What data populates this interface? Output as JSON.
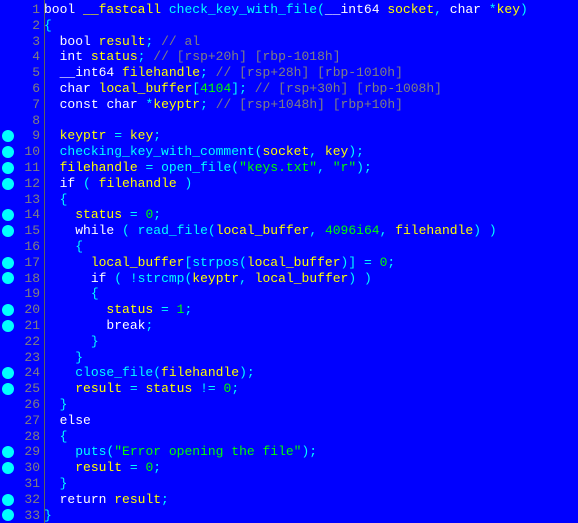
{
  "lines": [
    {
      "n": 1,
      "bp": false,
      "tokens": [
        [
          "ty",
          "bool"
        ],
        [
          "pl",
          " "
        ],
        [
          "id",
          "__fastcall"
        ],
        [
          "pl",
          " "
        ],
        [
          "fn",
          "check_key_with_file"
        ],
        [
          "pn",
          "("
        ],
        [
          "ty",
          "__int64"
        ],
        [
          "pl",
          " "
        ],
        [
          "id",
          "socket"
        ],
        [
          "pn",
          ","
        ],
        [
          "pl",
          " "
        ],
        [
          "ty",
          "char"
        ],
        [
          "pl",
          " "
        ],
        [
          "op",
          "*"
        ],
        [
          "id",
          "key"
        ],
        [
          "pn",
          ")"
        ]
      ]
    },
    {
      "n": 2,
      "bp": false,
      "tokens": [
        [
          "pn",
          "{"
        ]
      ]
    },
    {
      "n": 3,
      "bp": false,
      "tokens": [
        [
          "pl",
          "  "
        ],
        [
          "ty",
          "bool"
        ],
        [
          "pl",
          " "
        ],
        [
          "id",
          "result"
        ],
        [
          "pn",
          ";"
        ],
        [
          "pl",
          " "
        ],
        [
          "cmt",
          "// al"
        ]
      ]
    },
    {
      "n": 4,
      "bp": false,
      "tokens": [
        [
          "pl",
          "  "
        ],
        [
          "ty",
          "int"
        ],
        [
          "pl",
          " "
        ],
        [
          "id",
          "status"
        ],
        [
          "pn",
          ";"
        ],
        [
          "pl",
          " "
        ],
        [
          "cmt",
          "// [rsp+20h] [rbp-1018h]"
        ]
      ]
    },
    {
      "n": 5,
      "bp": false,
      "tokens": [
        [
          "pl",
          "  "
        ],
        [
          "ty",
          "__int64"
        ],
        [
          "pl",
          " "
        ],
        [
          "id",
          "filehandle"
        ],
        [
          "pn",
          ";"
        ],
        [
          "pl",
          " "
        ],
        [
          "cmt",
          "// [rsp+28h] [rbp-1010h]"
        ]
      ]
    },
    {
      "n": 6,
      "bp": false,
      "tokens": [
        [
          "pl",
          "  "
        ],
        [
          "ty",
          "char"
        ],
        [
          "pl",
          " "
        ],
        [
          "id",
          "local_buffer"
        ],
        [
          "pn",
          "["
        ],
        [
          "num",
          "4104"
        ],
        [
          "pn",
          "]"
        ],
        [
          "pn",
          ";"
        ],
        [
          "pl",
          " "
        ],
        [
          "cmt",
          "// [rsp+30h] [rbp-1008h]"
        ]
      ]
    },
    {
      "n": 7,
      "bp": false,
      "tokens": [
        [
          "pl",
          "  "
        ],
        [
          "ty",
          "const"
        ],
        [
          "pl",
          " "
        ],
        [
          "ty",
          "char"
        ],
        [
          "pl",
          " "
        ],
        [
          "op",
          "*"
        ],
        [
          "id",
          "keyptr"
        ],
        [
          "pn",
          ";"
        ],
        [
          "pl",
          " "
        ],
        [
          "cmt",
          "// [rsp+1048h] [rbp+10h]"
        ]
      ]
    },
    {
      "n": 8,
      "bp": false,
      "tokens": []
    },
    {
      "n": 9,
      "bp": true,
      "tokens": [
        [
          "pl",
          "  "
        ],
        [
          "id",
          "keyptr"
        ],
        [
          "pl",
          " "
        ],
        [
          "op",
          "="
        ],
        [
          "pl",
          " "
        ],
        [
          "id",
          "key"
        ],
        [
          "pn",
          ";"
        ]
      ]
    },
    {
      "n": 10,
      "bp": true,
      "tokens": [
        [
          "pl",
          "  "
        ],
        [
          "fn",
          "checking_key_with_comment"
        ],
        [
          "pn",
          "("
        ],
        [
          "id",
          "socket"
        ],
        [
          "pn",
          ","
        ],
        [
          "pl",
          " "
        ],
        [
          "id",
          "key"
        ],
        [
          "pn",
          ")"
        ],
        [
          "pn",
          ";"
        ]
      ]
    },
    {
      "n": 11,
      "bp": true,
      "tokens": [
        [
          "pl",
          "  "
        ],
        [
          "id",
          "filehandle"
        ],
        [
          "pl",
          " "
        ],
        [
          "op",
          "="
        ],
        [
          "pl",
          " "
        ],
        [
          "fn",
          "open_file"
        ],
        [
          "pn",
          "("
        ],
        [
          "str",
          "\"keys.txt\""
        ],
        [
          "pn",
          ","
        ],
        [
          "pl",
          " "
        ],
        [
          "str",
          "\"r\""
        ],
        [
          "pn",
          ")"
        ],
        [
          "pn",
          ";"
        ]
      ]
    },
    {
      "n": 12,
      "bp": true,
      "tokens": [
        [
          "pl",
          "  "
        ],
        [
          "kw",
          "if"
        ],
        [
          "pl",
          " "
        ],
        [
          "pn",
          "("
        ],
        [
          "pl",
          " "
        ],
        [
          "id",
          "filehandle"
        ],
        [
          "pl",
          " "
        ],
        [
          "pn",
          ")"
        ]
      ]
    },
    {
      "n": 13,
      "bp": false,
      "tokens": [
        [
          "pl",
          "  "
        ],
        [
          "pn",
          "{"
        ]
      ]
    },
    {
      "n": 14,
      "bp": true,
      "tokens": [
        [
          "pl",
          "    "
        ],
        [
          "id",
          "status"
        ],
        [
          "pl",
          " "
        ],
        [
          "op",
          "="
        ],
        [
          "pl",
          " "
        ],
        [
          "num",
          "0"
        ],
        [
          "pn",
          ";"
        ]
      ]
    },
    {
      "n": 15,
      "bp": true,
      "tokens": [
        [
          "pl",
          "    "
        ],
        [
          "kw",
          "while"
        ],
        [
          "pl",
          " "
        ],
        [
          "pn",
          "("
        ],
        [
          "pl",
          " "
        ],
        [
          "fn",
          "read_file"
        ],
        [
          "pn",
          "("
        ],
        [
          "id",
          "local_buffer"
        ],
        [
          "pn",
          ","
        ],
        [
          "pl",
          " "
        ],
        [
          "num",
          "4096i64"
        ],
        [
          "pn",
          ","
        ],
        [
          "pl",
          " "
        ],
        [
          "id",
          "filehandle"
        ],
        [
          "pn",
          ")"
        ],
        [
          "pl",
          " "
        ],
        [
          "pn",
          ")"
        ]
      ]
    },
    {
      "n": 16,
      "bp": false,
      "tokens": [
        [
          "pl",
          "    "
        ],
        [
          "pn",
          "{"
        ]
      ]
    },
    {
      "n": 17,
      "bp": true,
      "tokens": [
        [
          "pl",
          "      "
        ],
        [
          "id",
          "local_buffer"
        ],
        [
          "pn",
          "["
        ],
        [
          "fn",
          "strpos"
        ],
        [
          "pn",
          "("
        ],
        [
          "id",
          "local_buffer"
        ],
        [
          "pn",
          ")"
        ],
        [
          "pn",
          "]"
        ],
        [
          "pl",
          " "
        ],
        [
          "op",
          "="
        ],
        [
          "pl",
          " "
        ],
        [
          "num",
          "0"
        ],
        [
          "pn",
          ";"
        ]
      ]
    },
    {
      "n": 18,
      "bp": true,
      "tokens": [
        [
          "pl",
          "      "
        ],
        [
          "kw",
          "if"
        ],
        [
          "pl",
          " "
        ],
        [
          "pn",
          "("
        ],
        [
          "pl",
          " "
        ],
        [
          "op",
          "!"
        ],
        [
          "fn",
          "strcmp"
        ],
        [
          "pn",
          "("
        ],
        [
          "id",
          "keyptr"
        ],
        [
          "pn",
          ","
        ],
        [
          "pl",
          " "
        ],
        [
          "id",
          "local_buffer"
        ],
        [
          "pn",
          ")"
        ],
        [
          "pl",
          " "
        ],
        [
          "pn",
          ")"
        ]
      ]
    },
    {
      "n": 19,
      "bp": false,
      "tokens": [
        [
          "pl",
          "      "
        ],
        [
          "pn",
          "{"
        ]
      ]
    },
    {
      "n": 20,
      "bp": true,
      "tokens": [
        [
          "pl",
          "        "
        ],
        [
          "id",
          "status"
        ],
        [
          "pl",
          " "
        ],
        [
          "op",
          "="
        ],
        [
          "pl",
          " "
        ],
        [
          "num",
          "1"
        ],
        [
          "pn",
          ";"
        ]
      ]
    },
    {
      "n": 21,
      "bp": true,
      "tokens": [
        [
          "pl",
          "        "
        ],
        [
          "kw",
          "break"
        ],
        [
          "pn",
          ";"
        ]
      ]
    },
    {
      "n": 22,
      "bp": false,
      "tokens": [
        [
          "pl",
          "      "
        ],
        [
          "pn",
          "}"
        ]
      ]
    },
    {
      "n": 23,
      "bp": false,
      "tokens": [
        [
          "pl",
          "    "
        ],
        [
          "pn",
          "}"
        ]
      ]
    },
    {
      "n": 24,
      "bp": true,
      "tokens": [
        [
          "pl",
          "    "
        ],
        [
          "fn",
          "close_file"
        ],
        [
          "pn",
          "("
        ],
        [
          "id",
          "filehandle"
        ],
        [
          "pn",
          ")"
        ],
        [
          "pn",
          ";"
        ]
      ]
    },
    {
      "n": 25,
      "bp": true,
      "tokens": [
        [
          "pl",
          "    "
        ],
        [
          "id",
          "result"
        ],
        [
          "pl",
          " "
        ],
        [
          "op",
          "="
        ],
        [
          "pl",
          " "
        ],
        [
          "id",
          "status"
        ],
        [
          "pl",
          " "
        ],
        [
          "op",
          "!="
        ],
        [
          "pl",
          " "
        ],
        [
          "num",
          "0"
        ],
        [
          "pn",
          ";"
        ]
      ]
    },
    {
      "n": 26,
      "bp": false,
      "tokens": [
        [
          "pl",
          "  "
        ],
        [
          "pn",
          "}"
        ]
      ]
    },
    {
      "n": 27,
      "bp": false,
      "tokens": [
        [
          "pl",
          "  "
        ],
        [
          "kw",
          "else"
        ]
      ]
    },
    {
      "n": 28,
      "bp": false,
      "tokens": [
        [
          "pl",
          "  "
        ],
        [
          "pn",
          "{"
        ]
      ]
    },
    {
      "n": 29,
      "bp": true,
      "tokens": [
        [
          "pl",
          "    "
        ],
        [
          "fn",
          "puts"
        ],
        [
          "pn",
          "("
        ],
        [
          "str",
          "\"Error opening the file\""
        ],
        [
          "pn",
          ")"
        ],
        [
          "pn",
          ";"
        ]
      ]
    },
    {
      "n": 30,
      "bp": true,
      "tokens": [
        [
          "pl",
          "    "
        ],
        [
          "id",
          "result"
        ],
        [
          "pl",
          " "
        ],
        [
          "op",
          "="
        ],
        [
          "pl",
          " "
        ],
        [
          "num",
          "0"
        ],
        [
          "pn",
          ";"
        ]
      ]
    },
    {
      "n": 31,
      "bp": false,
      "tokens": [
        [
          "pl",
          "  "
        ],
        [
          "pn",
          "}"
        ]
      ]
    },
    {
      "n": 32,
      "bp": true,
      "tokens": [
        [
          "pl",
          "  "
        ],
        [
          "kw",
          "return"
        ],
        [
          "pl",
          " "
        ],
        [
          "id",
          "result"
        ],
        [
          "pn",
          ";"
        ]
      ]
    },
    {
      "n": 33,
      "bp": true,
      "tokens": [
        [
          "pn",
          "}"
        ]
      ]
    }
  ]
}
